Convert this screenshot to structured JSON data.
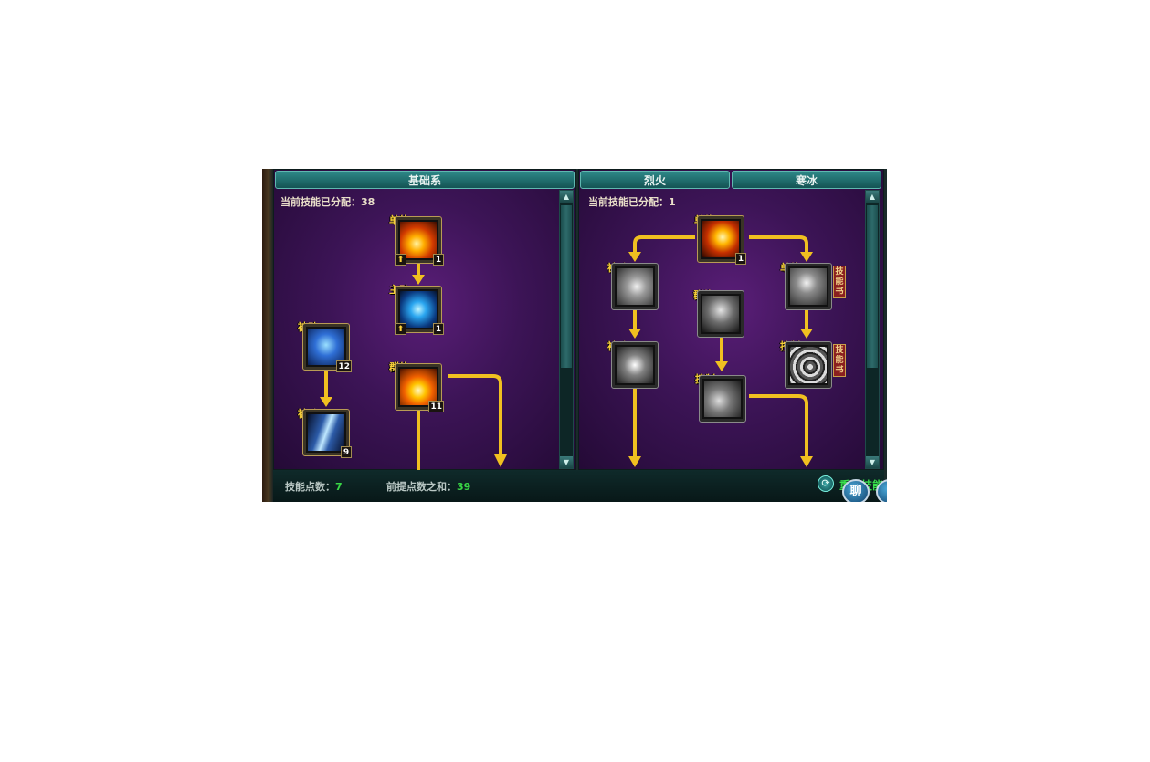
{
  "tabs": {
    "basic": "基础系",
    "fire": "烈火",
    "ice": "寒冰"
  },
  "left_panel": {
    "allocated_label": "当前技能已分配：",
    "allocated_value": "38",
    "skills": [
      {
        "tag": "单体",
        "level": "1",
        "upgradable": true,
        "icon": "fire-slash-icon"
      },
      {
        "tag": "主动",
        "level": "1",
        "upgradable": true,
        "icon": "lightning-orb-icon"
      },
      {
        "tag": "被动",
        "level": "12",
        "upgradable": false,
        "icon": "mage-aura-icon"
      },
      {
        "tag": "群体",
        "level": "11",
        "upgradable": false,
        "icon": "firestorm-icon"
      },
      {
        "tag": "被动",
        "level": "9",
        "upgradable": false,
        "icon": "ice-shards-icon"
      }
    ]
  },
  "right_panel": {
    "allocated_label": "当前技能已分配：",
    "allocated_value": "1",
    "skills": [
      {
        "tag": "单体",
        "level": "1",
        "icon": "fireball-icon",
        "active": true
      },
      {
        "tag": "被动",
        "icon": "claw-icon",
        "active": false
      },
      {
        "tag": "单体",
        "icon": "meteor-icon",
        "active": false,
        "book": "技能书"
      },
      {
        "tag": "群体",
        "icon": "shadow-warrior-icon",
        "active": false
      },
      {
        "tag": "被动",
        "icon": "meditation-icon",
        "active": false
      },
      {
        "tag": "控制",
        "icon": "vortex-icon",
        "active": false,
        "book": "技能书"
      },
      {
        "tag": "控制",
        "icon": "crouching-figure-icon",
        "active": false
      }
    ]
  },
  "bottom_bar": {
    "skill_points_label": "技能点数：",
    "skill_points_value": "7",
    "prereq_label": "前提点数之和：",
    "prereq_value": "39",
    "reset_label": "重置技能"
  },
  "corner_buttons": {
    "chat_label": "聊"
  },
  "colors": {
    "panel_purple": "#3c1456",
    "tab_teal": "#2e8888",
    "arrow_gold": "#f0c020",
    "tag_yellow": "#f7cf3a",
    "value_green": "#39d846"
  }
}
